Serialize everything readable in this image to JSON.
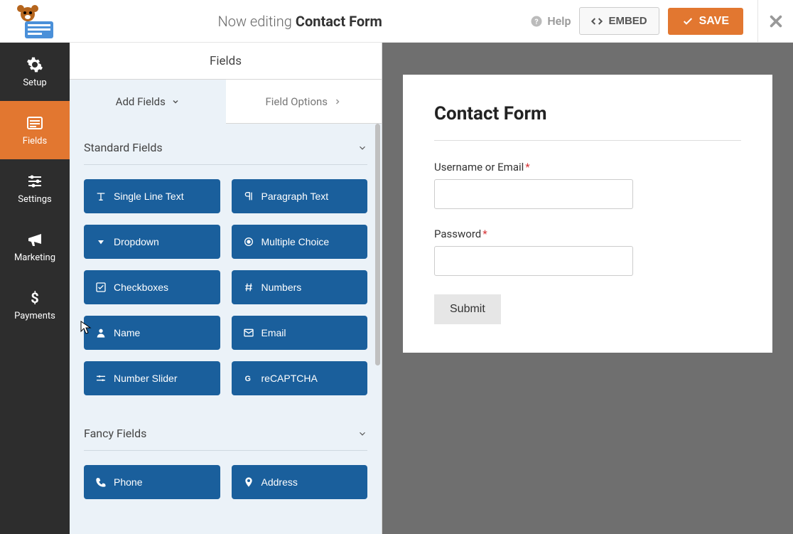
{
  "header": {
    "editing_prefix": "Now editing",
    "form_name": "Contact Form",
    "help": "Help",
    "embed": "EMBED",
    "save": "SAVE"
  },
  "sidebar": {
    "items": [
      {
        "label": "Setup"
      },
      {
        "label": "Fields"
      },
      {
        "label": "Settings"
      },
      {
        "label": "Marketing"
      },
      {
        "label": "Payments"
      }
    ]
  },
  "panel": {
    "title": "Fields",
    "tabs": {
      "add": "Add Fields",
      "options": "Field Options"
    },
    "sections": [
      {
        "title": "Standard Fields",
        "fields": [
          {
            "label": "Single Line Text",
            "icon": "text"
          },
          {
            "label": "Paragraph Text",
            "icon": "paragraph"
          },
          {
            "label": "Dropdown",
            "icon": "caret"
          },
          {
            "label": "Multiple Choice",
            "icon": "radio"
          },
          {
            "label": "Checkboxes",
            "icon": "check"
          },
          {
            "label": "Numbers",
            "icon": "hash"
          },
          {
            "label": "Name",
            "icon": "user"
          },
          {
            "label": "Email",
            "icon": "envelope"
          },
          {
            "label": "Number Slider",
            "icon": "sliders"
          },
          {
            "label": "reCAPTCHA",
            "icon": "google"
          }
        ]
      },
      {
        "title": "Fancy Fields",
        "fields": [
          {
            "label": "Phone",
            "icon": "phone"
          },
          {
            "label": "Address",
            "icon": "marker"
          }
        ]
      }
    ]
  },
  "preview": {
    "title": "Contact Form",
    "fields": [
      {
        "label": "Username or Email",
        "required": true
      },
      {
        "label": "Password",
        "required": true
      }
    ],
    "submit": "Submit"
  }
}
